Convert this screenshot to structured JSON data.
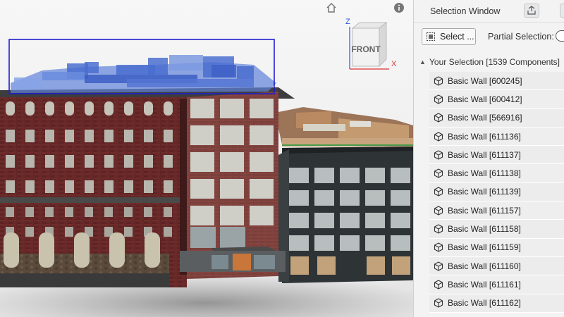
{
  "viewer": {
    "viewcube_face": "FRONT",
    "axis_z": "Z",
    "axis_x": "X",
    "home_icon": "home-icon",
    "info_icon": "info-icon"
  },
  "panel": {
    "title": "Selection Window",
    "dock_icon": "detach-icon",
    "select_label": "Select ...",
    "partial_label": "Partial Selection:",
    "partial_selection_on": false,
    "root_label": "Your Selection [1539 Components]",
    "items": [
      "Basic Wall [600245]",
      "Basic Wall [600412]",
      "Basic Wall [566916]",
      "Basic Wall [611136]",
      "Basic Wall [611137]",
      "Basic Wall [611138]",
      "Basic Wall [611139]",
      "Basic Wall [611157]",
      "Basic Wall [611158]",
      "Basic Wall [611159]",
      "Basic Wall [611160]",
      "Basic Wall [611161]",
      "Basic Wall [611162]"
    ]
  },
  "colors": {
    "selection_box": "#1f1fd0",
    "selection_highlight": "#4a6fd0",
    "brick": "#6b2a2a",
    "dark_facade": "#2e3336",
    "axis_z": "#3355dd",
    "axis_x": "#dd3333"
  }
}
